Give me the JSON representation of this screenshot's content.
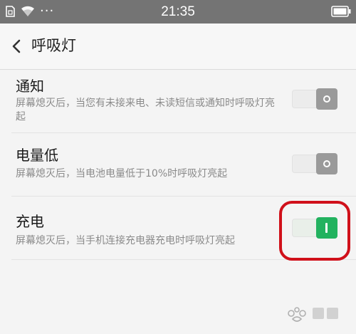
{
  "status_bar": {
    "time": "21:35",
    "more": "···",
    "icons": [
      "sim-card-icon",
      "wifi-icon",
      "battery-icon"
    ]
  },
  "header": {
    "title": "呼吸灯",
    "back_icon": "chevron-left-icon"
  },
  "settings": [
    {
      "title": "通知",
      "description": "屏幕熄灭后，当您有未接来电、未读短信或通知时呼吸灯亮起",
      "enabled": false
    },
    {
      "title": "电量低",
      "description": "屏幕熄灭后，当电池电量低于10%时呼吸灯亮起",
      "enabled": false
    },
    {
      "title": "充电",
      "description": "屏幕熄灭后，当手机连接充电器充电时呼吸灯亮起",
      "enabled": true
    }
  ],
  "colors": {
    "status_bar": "#747474",
    "toggle_on": "#22b25f",
    "toggle_off": "#9a9a9a",
    "annotation_circle": "#d0101a"
  }
}
